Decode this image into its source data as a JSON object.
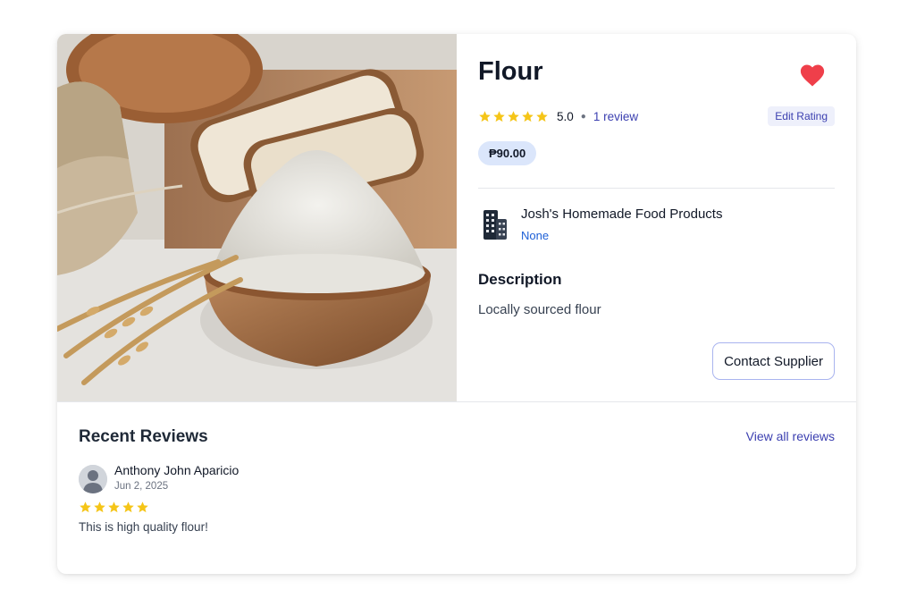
{
  "product": {
    "image_alt": "Flour in a wooden bowl with bread and wheat",
    "name": "Flour",
    "favorite": true,
    "rating_value": "5.0",
    "rating_stars": 5,
    "review_count_label": "1 review",
    "edit_rating_label": "Edit Rating",
    "price": "₱90.00",
    "description_heading": "Description",
    "description": "Locally sourced flour",
    "contact_button": "Contact Supplier"
  },
  "supplier": {
    "name": "Josh's Homemade Food Products",
    "subtitle": "None",
    "icon": "building-icon"
  },
  "reviews": {
    "heading": "Recent Reviews",
    "view_all_label": "View all reviews",
    "items": [
      {
        "author": "Anthony John Aparicio",
        "date": "Jun 2, 2025",
        "stars": 5,
        "text": "This is high quality flour!"
      }
    ]
  },
  "colors": {
    "star": "#f5c518",
    "heart": "#ef3f4a",
    "link": "#3b3fb0",
    "price_bg": "#dbe6fb"
  }
}
